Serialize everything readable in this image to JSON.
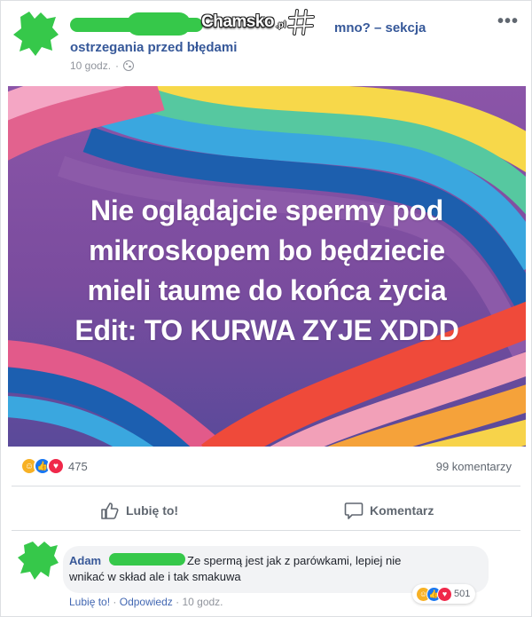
{
  "post": {
    "title_line1": "mno? – sekcja",
    "title_line2": "ostrzegania przed błędami",
    "time": "10 godz.",
    "dot": "·",
    "more_label": "•••",
    "image_text": [
      "Nie oglądajcie spermy pod",
      "mikroskopem bo będziecie",
      "mieli taume do końca życia",
      "Edit: TO KURWA ZYJE XDDD"
    ],
    "reaction_count": "475",
    "comments_count": "99 komentarzy",
    "like_label": "Lubię to!",
    "comment_label": "Komentarz"
  },
  "watermark": {
    "text": "Chamsko",
    "suffix": ".pl"
  },
  "comment": {
    "author": "Adam",
    "text_line1": "Ze spermą jest jak z parówkami, lepiej nie",
    "text_line2": "wnikać w skład ale i tak smakuwa",
    "reaction_count": "501",
    "like_label": "Lubię to!",
    "sep1": "·",
    "reply_label": "Odpowiedz",
    "sep2": "·",
    "time": "10 godz."
  },
  "icons": {
    "globe": "globe-icon",
    "like": "thumbs-up-icon",
    "comment": "speech-bubble-icon",
    "haha": "haha-reaction-icon",
    "like_reaction": "like-reaction-icon",
    "love": "love-reaction-icon"
  },
  "colors": {
    "link": "#365899",
    "meta_gray": "#90949c",
    "redaction_green": "#36c84a",
    "image_bg": "#7f4fa0"
  }
}
